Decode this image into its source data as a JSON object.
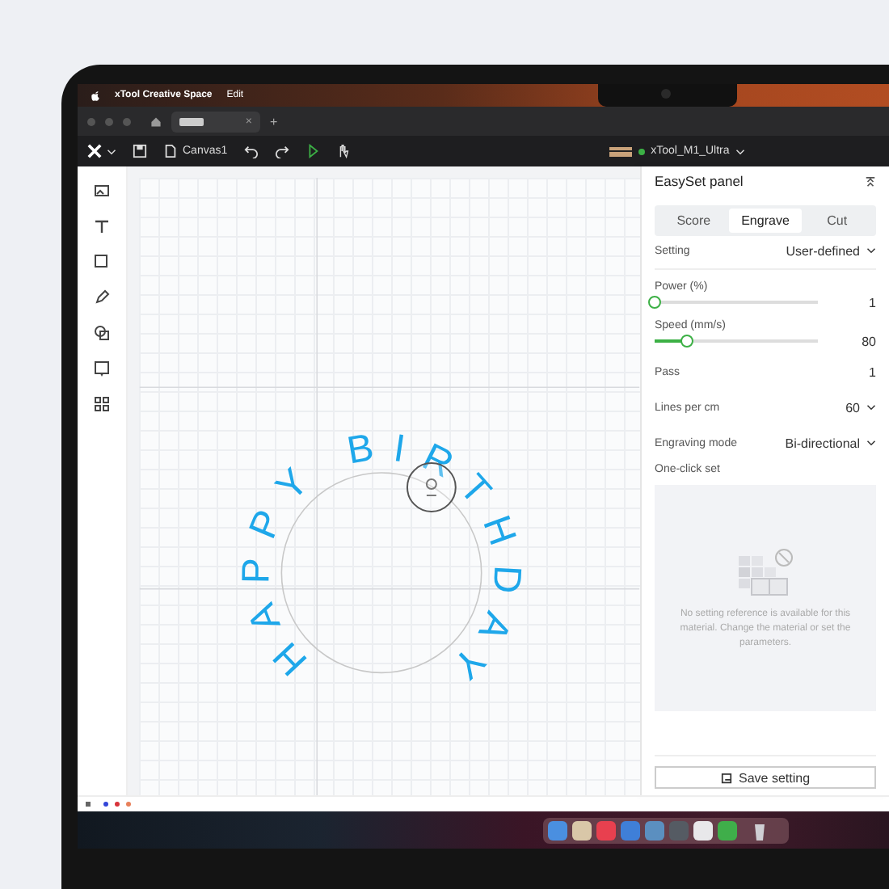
{
  "menu_bar": {
    "app_name": "xTool Creative Space",
    "menus": [
      "Edit"
    ]
  },
  "tab_bar": {
    "close": "×",
    "new_tab": "+"
  },
  "toolbar": {
    "file_name": "Canvas1",
    "device": "xTool_M1_Ultra",
    "connected": true
  },
  "canvas": {
    "curved_text": "HAPPY BIRTHDAY"
  },
  "panel": {
    "title": "EasySet panel",
    "tabs": [
      {
        "label": "Score",
        "selected": false
      },
      {
        "label": "Engrave",
        "selected": true
      },
      {
        "label": "Cut",
        "selected": false
      }
    ],
    "setting": {
      "label": "Setting",
      "value": "User-defined"
    },
    "sliders": [
      {
        "label": "Power (%)",
        "level": 0.0,
        "value": "1"
      },
      {
        "label": "Speed (mm/s)",
        "level": 0.2,
        "value": "80"
      }
    ],
    "fields": [
      {
        "kind": "plain",
        "label": "Pass",
        "value": "1"
      },
      {
        "kind": "dropdown",
        "label": "Lines per cm",
        "value": "60"
      },
      {
        "kind": "dropdown",
        "label": "Engraving mode",
        "value": "Bi-directional"
      }
    ],
    "one_click": {
      "title": "One-click set",
      "empty_message": "No setting reference is available for this material. Change the material or set the parameters."
    },
    "save_button": "Save setting"
  }
}
